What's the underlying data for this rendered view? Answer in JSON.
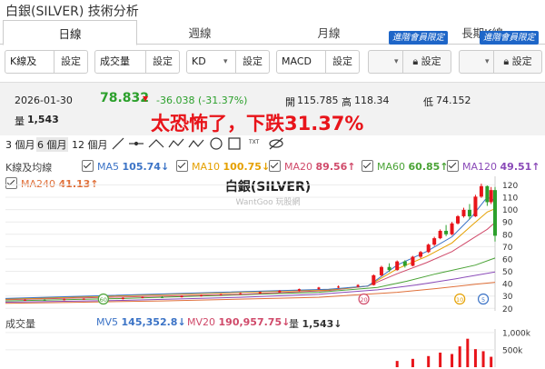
{
  "page": {
    "title": "白銀(SILVER) 技術分析",
    "annotation": "太恐怖了，下跌31.37%"
  },
  "tabs": [
    {
      "label": "日線",
      "active": true
    },
    {
      "label": "週線",
      "active": false
    },
    {
      "label": "月線",
      "active": false
    },
    {
      "label": "長期K線",
      "active": false
    }
  ],
  "vip_badge": "進階會員限定",
  "controls": [
    {
      "value": "K線及",
      "button": "設定"
    },
    {
      "value": "成交量",
      "button": "設定"
    },
    {
      "value": "KD",
      "button": "設定"
    },
    {
      "value": "MACD",
      "button": "設定"
    },
    {
      "value": "",
      "button": "設定",
      "locked": true
    },
    {
      "value": "",
      "button": "設定",
      "locked": true
    }
  ],
  "quote": {
    "date": "2026-01-30",
    "price": "78.832",
    "change": "-36.038 (-31.37%)",
    "open_label": "開",
    "open": "115.785",
    "high_label": "高",
    "high": "118.34",
    "low_label": "低",
    "low": "74.152",
    "volume_label": "量",
    "volume": "1,543",
    "up_color": "#2ca02c",
    "down_color": "#e8141a"
  },
  "periods": [
    "3 個月",
    "6 個月",
    "12 個月"
  ],
  "ma_legend": {
    "section_label": "K線及均線",
    "items": [
      {
        "label": "MA5",
        "value": "105.74",
        "arrow": "↓",
        "color": "#3b73c6"
      },
      {
        "label": "MA10",
        "value": "100.75",
        "arrow": "↓",
        "color": "#e5a000"
      },
      {
        "label": "MA20",
        "value": "89.56",
        "arrow": "↑",
        "color": "#d04a6a"
      },
      {
        "label": "MA60",
        "value": "60.85",
        "arrow": "↑",
        "color": "#4aa336"
      },
      {
        "label": "MA120",
        "value": "49.51",
        "arrow": "↑",
        "color": "#8a4ab8"
      },
      {
        "label": "MA240",
        "value": "41.13",
        "arrow": "↑",
        "color": "#e0703a"
      }
    ]
  },
  "volume_legend": {
    "section_label": "成交量",
    "items": [
      {
        "label": "MV5",
        "value": "145,352.8",
        "arrow": "↓",
        "color": "#3b73c6"
      },
      {
        "label": "MV20",
        "value": "190,957.75",
        "arrow": "↓",
        "color": "#d04a6a"
      },
      {
        "label": "量",
        "value": "1,543",
        "arrow": "↓",
        "color": "#333333"
      }
    ]
  },
  "chart_data": {
    "type": "line",
    "title": "白銀(SILVER)",
    "watermark": "WantGoo 玩股網",
    "y_ticks": [
      20,
      30,
      40,
      50,
      60,
      70,
      80,
      90,
      100,
      110,
      120
    ],
    "ylim": [
      18,
      124
    ],
    "x_index_range": [
      0,
      250
    ],
    "series": [
      {
        "name": "MA240",
        "color": "#e0703a",
        "points": [
          [
            0,
            24
          ],
          [
            40,
            25
          ],
          [
            80,
            26
          ],
          [
            120,
            27.5
          ],
          [
            160,
            29
          ],
          [
            200,
            33
          ],
          [
            220,
            36
          ],
          [
            240,
            39.5
          ],
          [
            250,
            41.1
          ]
        ]
      },
      {
        "name": "MA120",
        "color": "#8a4ab8",
        "points": [
          [
            0,
            25
          ],
          [
            60,
            26.5
          ],
          [
            120,
            29
          ],
          [
            160,
            31.5
          ],
          [
            190,
            35
          ],
          [
            210,
            39
          ],
          [
            230,
            44
          ],
          [
            250,
            49.5
          ]
        ]
      },
      {
        "name": "MA60",
        "color": "#4aa336",
        "points": [
          [
            0,
            26
          ],
          [
            60,
            28
          ],
          [
            120,
            31
          ],
          [
            160,
            33
          ],
          [
            190,
            37
          ],
          [
            205,
            42
          ],
          [
            220,
            48
          ],
          [
            240,
            55
          ],
          [
            250,
            60.8
          ]
        ]
      },
      {
        "name": "MA20",
        "color": "#d04a6a",
        "points": [
          [
            0,
            27
          ],
          [
            120,
            31.5
          ],
          [
            165,
            34.5
          ],
          [
            185,
            38
          ],
          [
            200,
            48
          ],
          [
            215,
            57
          ],
          [
            228,
            66
          ],
          [
            238,
            76
          ],
          [
            246,
            84
          ],
          [
            250,
            89.6
          ]
        ]
      },
      {
        "name": "MA10",
        "color": "#e5a000",
        "points": [
          [
            0,
            27.5
          ],
          [
            165,
            35
          ],
          [
            185,
            38
          ],
          [
            200,
            52
          ],
          [
            215,
            62
          ],
          [
            228,
            73
          ],
          [
            238,
            87
          ],
          [
            246,
            98
          ],
          [
            250,
            100.7
          ]
        ]
      },
      {
        "name": "MA5",
        "color": "#3b73c6",
        "points": [
          [
            0,
            28
          ],
          [
            165,
            35.5
          ],
          [
            185,
            38
          ],
          [
            200,
            55
          ],
          [
            215,
            66
          ],
          [
            228,
            78
          ],
          [
            238,
            94
          ],
          [
            245,
            108
          ],
          [
            248,
            110
          ],
          [
            250,
            105.7
          ]
        ]
      }
    ],
    "candles": [
      {
        "i": 10,
        "o": 26.5,
        "h": 27.2,
        "l": 26.1,
        "c": 26.9
      },
      {
        "i": 20,
        "o": 26.9,
        "h": 27.5,
        "l": 26.3,
        "c": 26.6
      },
      {
        "i": 30,
        "o": 26.6,
        "h": 27.8,
        "l": 26.4,
        "c": 27.4
      },
      {
        "i": 40,
        "o": 27.4,
        "h": 28.1,
        "l": 27.0,
        "c": 27.8
      },
      {
        "i": 50,
        "o": 27.8,
        "h": 28.4,
        "l": 27.2,
        "c": 27.5
      },
      {
        "i": 60,
        "o": 27.5,
        "h": 28.8,
        "l": 27.3,
        "c": 28.5
      },
      {
        "i": 70,
        "o": 28.5,
        "h": 29.4,
        "l": 28.2,
        "c": 29.1
      },
      {
        "i": 80,
        "o": 29.1,
        "h": 29.9,
        "l": 28.6,
        "c": 29.0
      },
      {
        "i": 90,
        "o": 29.0,
        "h": 30.3,
        "l": 28.8,
        "c": 30.0
      },
      {
        "i": 100,
        "o": 30.0,
        "h": 31.0,
        "l": 29.6,
        "c": 30.6
      },
      {
        "i": 110,
        "o": 30.6,
        "h": 31.8,
        "l": 30.3,
        "c": 31.4
      },
      {
        "i": 120,
        "o": 31.4,
        "h": 32.6,
        "l": 31.0,
        "c": 32.2
      },
      {
        "i": 130,
        "o": 32.2,
        "h": 33.5,
        "l": 31.8,
        "c": 33.1
      },
      {
        "i": 140,
        "o": 33.1,
        "h": 34.8,
        "l": 32.7,
        "c": 34.3
      },
      {
        "i": 150,
        "o": 34.3,
        "h": 36.0,
        "l": 33.8,
        "c": 35.6
      },
      {
        "i": 160,
        "o": 35.6,
        "h": 37.4,
        "l": 35.0,
        "c": 36.9
      },
      {
        "i": 170,
        "o": 36.9,
        "h": 38.5,
        "l": 36.4,
        "c": 37.6
      },
      {
        "i": 180,
        "o": 37.6,
        "h": 39.5,
        "l": 37.0,
        "c": 38.9
      },
      {
        "i": 188,
        "o": 38.9,
        "h": 47.5,
        "l": 38.5,
        "c": 46.8
      },
      {
        "i": 192,
        "o": 46.8,
        "h": 54.5,
        "l": 46.0,
        "c": 53.5
      },
      {
        "i": 196,
        "o": 53.5,
        "h": 56.5,
        "l": 49.5,
        "c": 51.0
      },
      {
        "i": 200,
        "o": 51.0,
        "h": 58.8,
        "l": 50.5,
        "c": 58.0
      },
      {
        "i": 204,
        "o": 58.0,
        "h": 59.0,
        "l": 53.0,
        "c": 54.5
      },
      {
        "i": 208,
        "o": 54.5,
        "h": 62.5,
        "l": 54.0,
        "c": 61.8
      },
      {
        "i": 212,
        "o": 61.8,
        "h": 66.5,
        "l": 60.5,
        "c": 65.6
      },
      {
        "i": 216,
        "o": 65.6,
        "h": 72.5,
        "l": 64.8,
        "c": 71.6
      },
      {
        "i": 219,
        "o": 71.6,
        "h": 78.0,
        "l": 70.5,
        "c": 76.8
      },
      {
        "i": 222,
        "o": 76.8,
        "h": 84.0,
        "l": 76.0,
        "c": 82.8
      },
      {
        "i": 225,
        "o": 82.8,
        "h": 87.5,
        "l": 78.5,
        "c": 80.0
      },
      {
        "i": 228,
        "o": 80.0,
        "h": 90.0,
        "l": 79.2,
        "c": 88.8
      },
      {
        "i": 231,
        "o": 88.8,
        "h": 95.5,
        "l": 88.0,
        "c": 94.6
      },
      {
        "i": 234,
        "o": 94.6,
        "h": 101.5,
        "l": 93.5,
        "c": 99.8
      },
      {
        "i": 237,
        "o": 99.8,
        "h": 104.5,
        "l": 92.0,
        "c": 94.5
      },
      {
        "i": 240,
        "o": 94.5,
        "h": 112.0,
        "l": 94.0,
        "c": 110.5
      },
      {
        "i": 243,
        "o": 110.5,
        "h": 121.0,
        "l": 109.5,
        "c": 119.0
      },
      {
        "i": 246,
        "o": 119.0,
        "h": 119.5,
        "l": 103.0,
        "c": 106.0
      },
      {
        "i": 248,
        "o": 106.0,
        "h": 118.3,
        "l": 104.5,
        "c": 115.8
      },
      {
        "i": 250,
        "o": 115.785,
        "h": 118.34,
        "l": 74.152,
        "c": 78.832
      }
    ],
    "markers": [
      {
        "i": 50,
        "label": "60",
        "color": "#4aa336"
      },
      {
        "i": 183,
        "label": "20",
        "color": "#d04a6a"
      },
      {
        "i": 232,
        "label": "10",
        "color": "#e5a000"
      },
      {
        "i": 244,
        "label": "5",
        "color": "#3b73c6"
      }
    ],
    "volume": {
      "y_ticks": [
        {
          "v": 1000000,
          "label": "1,000k"
        },
        {
          "v": 500000,
          "label": "500k"
        }
      ],
      "ylim": [
        0,
        1100000
      ],
      "bars": [
        {
          "i": 200,
          "v": 180000
        },
        {
          "i": 208,
          "v": 240000
        },
        {
          "i": 216,
          "v": 320000
        },
        {
          "i": 222,
          "v": 420000
        },
        {
          "i": 228,
          "v": 380000
        },
        {
          "i": 232,
          "v": 600000
        },
        {
          "i": 236,
          "v": 820000
        },
        {
          "i": 240,
          "v": 520000
        },
        {
          "i": 244,
          "v": 460000
        },
        {
          "i": 248,
          "v": 300000
        }
      ]
    }
  }
}
